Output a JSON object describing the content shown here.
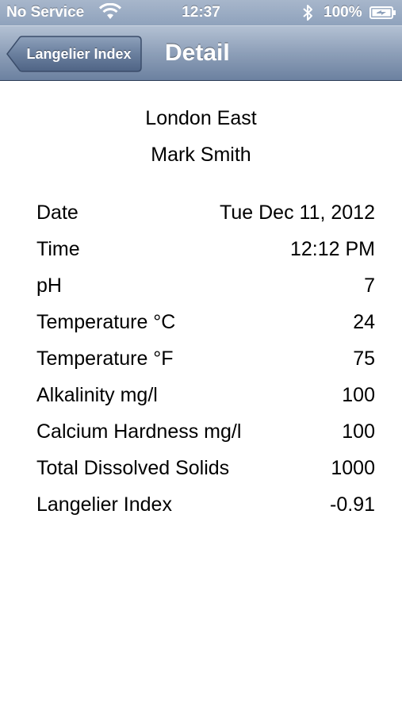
{
  "status_bar": {
    "carrier": "No Service",
    "time": "12:37",
    "battery_percent": "100%",
    "icons": [
      "wifi-icon",
      "bluetooth-icon",
      "battery-icon"
    ]
  },
  "nav_bar": {
    "back_label": "Langelier Index",
    "title": "Detail"
  },
  "header": {
    "location": "London East",
    "name": "Mark Smith"
  },
  "details": [
    {
      "label": "Date",
      "value": "Tue Dec 11, 2012"
    },
    {
      "label": "Time",
      "value": "12:12 PM"
    },
    {
      "label": "pH",
      "value": "7"
    },
    {
      "label": "Temperature °C",
      "value": "24"
    },
    {
      "label": "Temperature °F",
      "value": "75"
    },
    {
      "label": "Alkalinity mg/l",
      "value": "100"
    },
    {
      "label": "Calcium Hardness mg/l",
      "value": "100"
    },
    {
      "label": "Total Dissolved Solids",
      "value": "1000"
    },
    {
      "label": "Langelier Index",
      "value": "-0.91"
    }
  ],
  "colors": {
    "nav_bar_top": "#b3c1d3",
    "nav_bar_bottom": "#6c81a0",
    "status_bar": "#a7b6cb",
    "text": "#000000"
  }
}
